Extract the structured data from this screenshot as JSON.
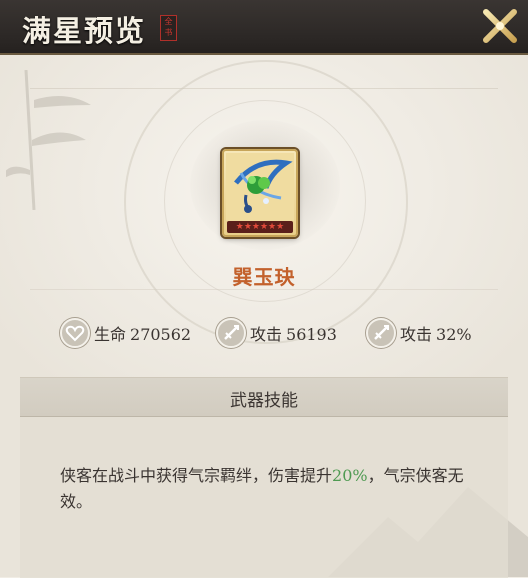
{
  "header": {
    "title": "满星预览",
    "seal_text": "全书"
  },
  "item": {
    "name": "巽玉玦",
    "stars": "★★★★★★"
  },
  "stats": [
    {
      "icon": "heart-icon",
      "label": "生命",
      "value": "270562"
    },
    {
      "icon": "sword-icon",
      "label": "攻击",
      "value": "56193"
    },
    {
      "icon": "sword-icon",
      "label": "攻击",
      "value": "32%"
    }
  ],
  "skill": {
    "title": "武器技能",
    "desc_before": "侠客在战斗中获得气宗羁绊，伤害提升",
    "desc_highlight": "20%",
    "desc_after": "，气宗侠客无效。"
  },
  "colors": {
    "highlight": "#4f9a52",
    "item_name": "#c3612c"
  }
}
